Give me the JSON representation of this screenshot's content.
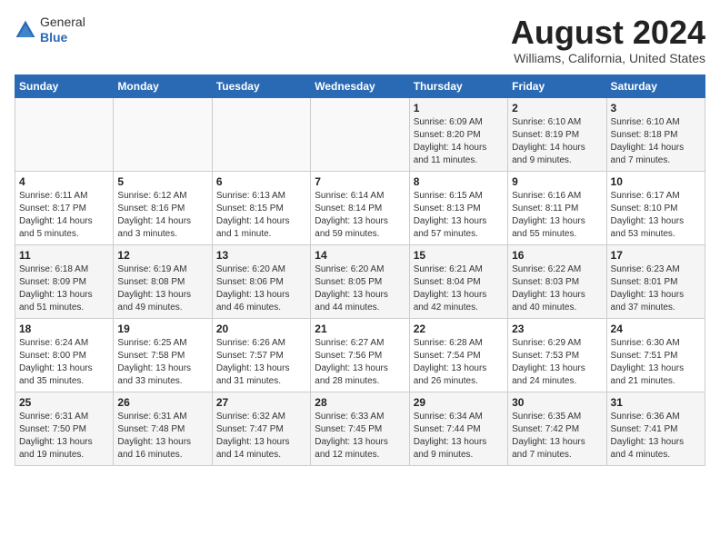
{
  "header": {
    "logo": {
      "general": "General",
      "blue": "Blue"
    },
    "title": "August 2024",
    "location": "Williams, California, United States"
  },
  "calendar": {
    "days_of_week": [
      "Sunday",
      "Monday",
      "Tuesday",
      "Wednesday",
      "Thursday",
      "Friday",
      "Saturday"
    ],
    "weeks": [
      [
        {
          "day": "",
          "info": ""
        },
        {
          "day": "",
          "info": ""
        },
        {
          "day": "",
          "info": ""
        },
        {
          "day": "",
          "info": ""
        },
        {
          "day": "1",
          "info": "Sunrise: 6:09 AM\nSunset: 8:20 PM\nDaylight: 14 hours\nand 11 minutes."
        },
        {
          "day": "2",
          "info": "Sunrise: 6:10 AM\nSunset: 8:19 PM\nDaylight: 14 hours\nand 9 minutes."
        },
        {
          "day": "3",
          "info": "Sunrise: 6:10 AM\nSunset: 8:18 PM\nDaylight: 14 hours\nand 7 minutes."
        }
      ],
      [
        {
          "day": "4",
          "info": "Sunrise: 6:11 AM\nSunset: 8:17 PM\nDaylight: 14 hours\nand 5 minutes."
        },
        {
          "day": "5",
          "info": "Sunrise: 6:12 AM\nSunset: 8:16 PM\nDaylight: 14 hours\nand 3 minutes."
        },
        {
          "day": "6",
          "info": "Sunrise: 6:13 AM\nSunset: 8:15 PM\nDaylight: 14 hours\nand 1 minute."
        },
        {
          "day": "7",
          "info": "Sunrise: 6:14 AM\nSunset: 8:14 PM\nDaylight: 13 hours\nand 59 minutes."
        },
        {
          "day": "8",
          "info": "Sunrise: 6:15 AM\nSunset: 8:13 PM\nDaylight: 13 hours\nand 57 minutes."
        },
        {
          "day": "9",
          "info": "Sunrise: 6:16 AM\nSunset: 8:11 PM\nDaylight: 13 hours\nand 55 minutes."
        },
        {
          "day": "10",
          "info": "Sunrise: 6:17 AM\nSunset: 8:10 PM\nDaylight: 13 hours\nand 53 minutes."
        }
      ],
      [
        {
          "day": "11",
          "info": "Sunrise: 6:18 AM\nSunset: 8:09 PM\nDaylight: 13 hours\nand 51 minutes."
        },
        {
          "day": "12",
          "info": "Sunrise: 6:19 AM\nSunset: 8:08 PM\nDaylight: 13 hours\nand 49 minutes."
        },
        {
          "day": "13",
          "info": "Sunrise: 6:20 AM\nSunset: 8:06 PM\nDaylight: 13 hours\nand 46 minutes."
        },
        {
          "day": "14",
          "info": "Sunrise: 6:20 AM\nSunset: 8:05 PM\nDaylight: 13 hours\nand 44 minutes."
        },
        {
          "day": "15",
          "info": "Sunrise: 6:21 AM\nSunset: 8:04 PM\nDaylight: 13 hours\nand 42 minutes."
        },
        {
          "day": "16",
          "info": "Sunrise: 6:22 AM\nSunset: 8:03 PM\nDaylight: 13 hours\nand 40 minutes."
        },
        {
          "day": "17",
          "info": "Sunrise: 6:23 AM\nSunset: 8:01 PM\nDaylight: 13 hours\nand 37 minutes."
        }
      ],
      [
        {
          "day": "18",
          "info": "Sunrise: 6:24 AM\nSunset: 8:00 PM\nDaylight: 13 hours\nand 35 minutes."
        },
        {
          "day": "19",
          "info": "Sunrise: 6:25 AM\nSunset: 7:58 PM\nDaylight: 13 hours\nand 33 minutes."
        },
        {
          "day": "20",
          "info": "Sunrise: 6:26 AM\nSunset: 7:57 PM\nDaylight: 13 hours\nand 31 minutes."
        },
        {
          "day": "21",
          "info": "Sunrise: 6:27 AM\nSunset: 7:56 PM\nDaylight: 13 hours\nand 28 minutes."
        },
        {
          "day": "22",
          "info": "Sunrise: 6:28 AM\nSunset: 7:54 PM\nDaylight: 13 hours\nand 26 minutes."
        },
        {
          "day": "23",
          "info": "Sunrise: 6:29 AM\nSunset: 7:53 PM\nDaylight: 13 hours\nand 24 minutes."
        },
        {
          "day": "24",
          "info": "Sunrise: 6:30 AM\nSunset: 7:51 PM\nDaylight: 13 hours\nand 21 minutes."
        }
      ],
      [
        {
          "day": "25",
          "info": "Sunrise: 6:31 AM\nSunset: 7:50 PM\nDaylight: 13 hours\nand 19 minutes."
        },
        {
          "day": "26",
          "info": "Sunrise: 6:31 AM\nSunset: 7:48 PM\nDaylight: 13 hours\nand 16 minutes."
        },
        {
          "day": "27",
          "info": "Sunrise: 6:32 AM\nSunset: 7:47 PM\nDaylight: 13 hours\nand 14 minutes."
        },
        {
          "day": "28",
          "info": "Sunrise: 6:33 AM\nSunset: 7:45 PM\nDaylight: 13 hours\nand 12 minutes."
        },
        {
          "day": "29",
          "info": "Sunrise: 6:34 AM\nSunset: 7:44 PM\nDaylight: 13 hours\nand 9 minutes."
        },
        {
          "day": "30",
          "info": "Sunrise: 6:35 AM\nSunset: 7:42 PM\nDaylight: 13 hours\nand 7 minutes."
        },
        {
          "day": "31",
          "info": "Sunrise: 6:36 AM\nSunset: 7:41 PM\nDaylight: 13 hours\nand 4 minutes."
        }
      ]
    ]
  }
}
